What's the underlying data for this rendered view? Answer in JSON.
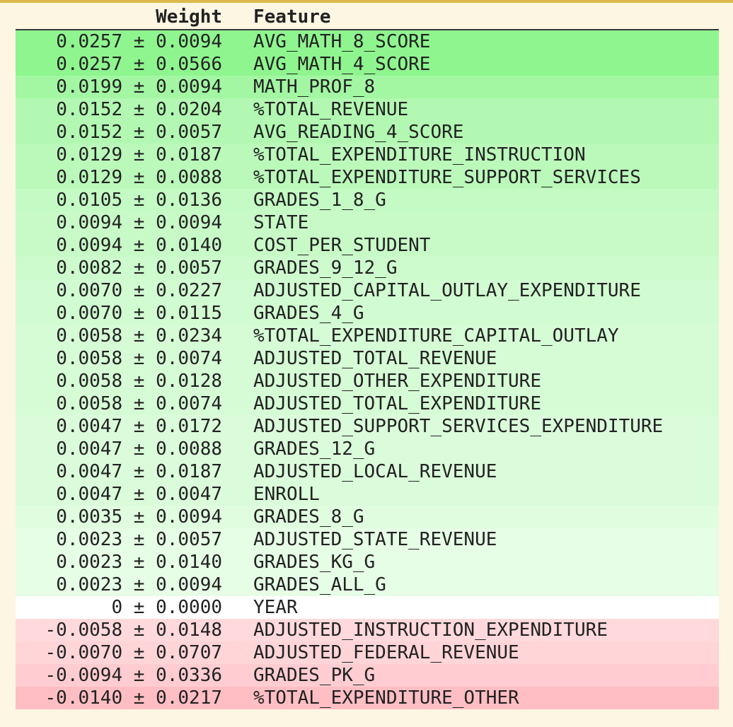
{
  "header": {
    "weight_label": "Weight",
    "feature_label": "Feature"
  },
  "colors": {
    "page_background": "#fdf6e3",
    "top_border": "#dcb94c",
    "header_rule": "#3a3a3a",
    "positive_strong": "#8ff58f",
    "neutral": "#ffffff",
    "negative_strong": "#ffb8be"
  },
  "rows": [
    {
      "weight": "0.0257",
      "std": "0.0094",
      "feature": "AVG_MATH_8_SCORE",
      "bg": "#8ff58f"
    },
    {
      "weight": "0.0257",
      "std": "0.0566",
      "feature": "AVG_MATH_4_SCORE",
      "bg": "#8ff58f"
    },
    {
      "weight": "0.0199",
      "std": "0.0094",
      "feature": "MATH_PROF_8",
      "bg": "#a3f7a3"
    },
    {
      "weight": "0.0152",
      "std": "0.0204",
      "feature": "%TOTAL_REVENUE",
      "bg": "#b2f8b2"
    },
    {
      "weight": "0.0152",
      "std": "0.0057",
      "feature": "AVG_READING_4_SCORE",
      "bg": "#b2f8b2"
    },
    {
      "weight": "0.0129",
      "std": "0.0187",
      "feature": "%TOTAL_EXPENDITURE_INSTRUCTION",
      "bg": "#bbf9bb"
    },
    {
      "weight": "0.0129",
      "std": "0.0088",
      "feature": "%TOTAL_EXPENDITURE_SUPPORT_SERVICES",
      "bg": "#bbf9bb"
    },
    {
      "weight": "0.0105",
      "std": "0.0136",
      "feature": "GRADES_1_8_G",
      "bg": "#c4fac4"
    },
    {
      "weight": "0.0094",
      "std": "0.0094",
      "feature": "STATE",
      "bg": "#c8fac8"
    },
    {
      "weight": "0.0094",
      "std": "0.0140",
      "feature": "COST_PER_STUDENT",
      "bg": "#c8fac8"
    },
    {
      "weight": "0.0082",
      "std": "0.0057",
      "feature": "GRADES_9_12_G",
      "bg": "#cdfbcd"
    },
    {
      "weight": "0.0070",
      "std": "0.0227",
      "feature": "ADJUSTED_CAPITAL_OUTLAY_EXPENDITURE",
      "bg": "#d1fbd1"
    },
    {
      "weight": "0.0070",
      "std": "0.0115",
      "feature": "GRADES_4_G",
      "bg": "#d1fbd1"
    },
    {
      "weight": "0.0058",
      "std": "0.0234",
      "feature": "%TOTAL_EXPENDITURE_CAPITAL_OUTLAY",
      "bg": "#d6fcd6"
    },
    {
      "weight": "0.0058",
      "std": "0.0074",
      "feature": "ADJUSTED_TOTAL_REVENUE",
      "bg": "#d6fcd6"
    },
    {
      "weight": "0.0058",
      "std": "0.0128",
      "feature": "ADJUSTED_OTHER_EXPENDITURE",
      "bg": "#d6fcd6"
    },
    {
      "weight": "0.0058",
      "std": "0.0074",
      "feature": "ADJUSTED_TOTAL_EXPENDITURE",
      "bg": "#d6fcd6"
    },
    {
      "weight": "0.0047",
      "std": "0.0172",
      "feature": "ADJUSTED_SUPPORT_SERVICES_EXPENDITURE",
      "bg": "#dbfcdb"
    },
    {
      "weight": "0.0047",
      "std": "0.0088",
      "feature": "GRADES_12_G",
      "bg": "#dbfcdb"
    },
    {
      "weight": "0.0047",
      "std": "0.0187",
      "feature": "ADJUSTED_LOCAL_REVENUE",
      "bg": "#dbfcdb"
    },
    {
      "weight": "0.0047",
      "std": "0.0047",
      "feature": "ENROLL",
      "bg": "#dbfcdb"
    },
    {
      "weight": "0.0035",
      "std": "0.0094",
      "feature": "GRADES_8_G",
      "bg": "#e0fde0"
    },
    {
      "weight": "0.0023",
      "std": "0.0057",
      "feature": "ADJUSTED_STATE_REVENUE",
      "bg": "#e6fde6"
    },
    {
      "weight": "0.0023",
      "std": "0.0140",
      "feature": "GRADES_KG_G",
      "bg": "#e6fde6"
    },
    {
      "weight": "0.0023",
      "std": "0.0094",
      "feature": "GRADES_ALL_G",
      "bg": "#e6fde6"
    },
    {
      "weight": "0",
      "std": "0.0000",
      "feature": "YEAR",
      "bg": "#ffffff"
    },
    {
      "weight": "-0.0058",
      "std": "0.0148",
      "feature": "ADJUSTED_INSTRUCTION_EXPENDITURE",
      "bg": "#ffd9dc"
    },
    {
      "weight": "-0.0070",
      "std": "0.0707",
      "feature": "ADJUSTED_FEDERAL_REVENUE",
      "bg": "#ffd5d8"
    },
    {
      "weight": "-0.0094",
      "std": "0.0336",
      "feature": "GRADES_PK_G",
      "bg": "#ffcdd1"
    },
    {
      "weight": "-0.0140",
      "std": "0.0217",
      "feature": "%TOTAL_EXPENDITURE_OTHER",
      "bg": "#ffbec4"
    }
  ]
}
